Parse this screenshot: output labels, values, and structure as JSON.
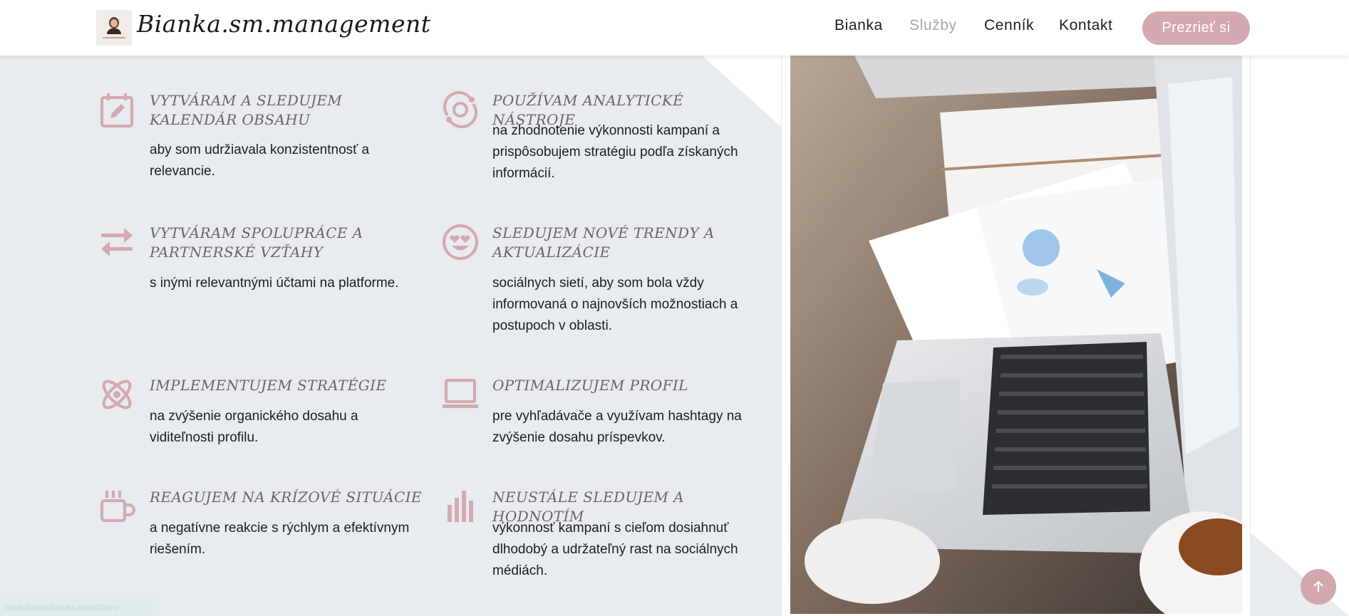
{
  "header": {
    "logo_text": "Bianka.sm.management",
    "nav": [
      {
        "label": "Bianka"
      },
      {
        "label": "Služby"
      },
      {
        "label": "Cenník"
      },
      {
        "label": "Kontakt"
      }
    ],
    "cta_label": "Prezrieť si"
  },
  "services": [
    {
      "icon": "calendar-edit-icon",
      "title": "VYTVÁRAM A SLEDUJEM KALENDÁR OBSAHU",
      "desc": "aby som udržiavala konzistentnosť a relevancie."
    },
    {
      "icon": "analytics-cycle-icon",
      "title": "POUŽÍVAM ANALYTICKÉ NÁSTROJE",
      "desc": "na zhodnotenie výkonnosti kampaní a prispôsobujem stratégiu podľa získaných informácií."
    },
    {
      "icon": "swap-arrows-icon",
      "title": "VYTVÁRAM SPOLUPRÁCE A PARTNERSKÉ VZŤAHY",
      "desc": "s inými relevantnými účtami na platforme."
    },
    {
      "icon": "heart-eyes-smiley-icon",
      "title": "SLEDUJEM NOVÉ TRENDY A AKTUALIZÁCIE",
      "desc": "sociálnych sietí, aby som bola vždy informovaná o najnovších možnostiach a postupoch v oblasti."
    },
    {
      "icon": "atom-icon",
      "title": "IMPLEMENTUJEM STRATÉGIE",
      "desc": "na zvýšenie organického dosahu a viditeľnosti profilu."
    },
    {
      "icon": "laptop-icon",
      "title": "OPTIMALIZUJEM PROFIL",
      "desc": "pre vyhľadávače a využívam hashtagy na zvýšenie dosahu príspevkov."
    },
    {
      "icon": "coffee-cup-icon",
      "title": "REAGUJEM NA KRÍZOVÉ SITUÁCIE",
      "desc": "a negatívne reakcie s rýchlym a efektívnym riešením."
    },
    {
      "icon": "bar-chart-icon",
      "title": "NEUSTÁLE SLEDUJEM A HODNOTÍM",
      "desc": "výkonnosť kampaní s cieľom dosiahnuť dlhodobý a udržateľný rast na sociálnych médiách."
    }
  ],
  "status_bar": {
    "url": "https://www.bianka.com/#hero"
  },
  "colors": {
    "accent": "#d4a9b1",
    "icon": "#d3aab0",
    "panel": "#e8ebef"
  }
}
